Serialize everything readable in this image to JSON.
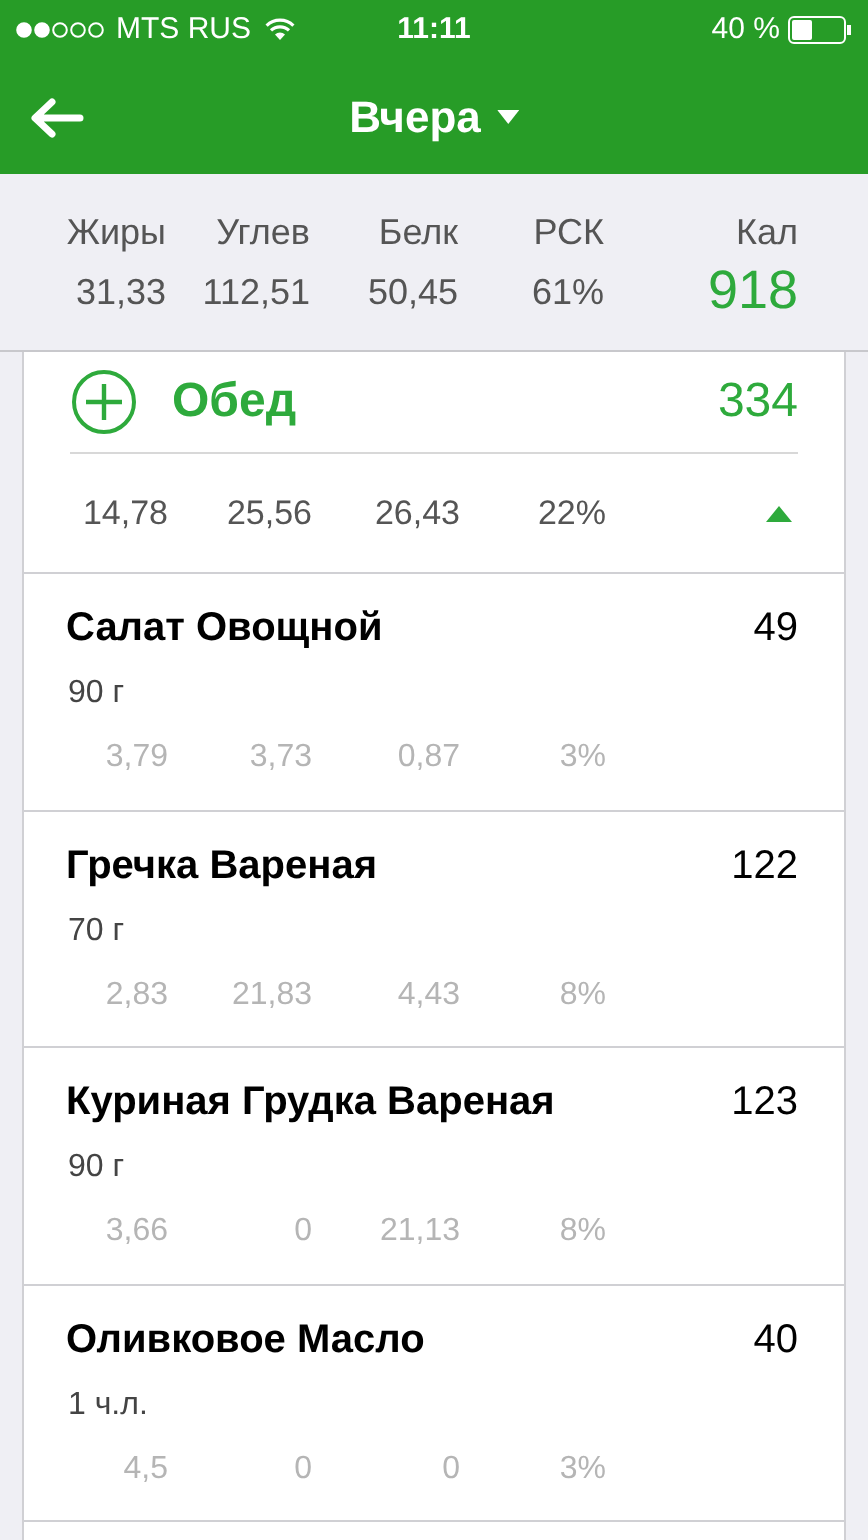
{
  "status_bar": {
    "carrier": "MTS RUS",
    "time": "11:11",
    "battery": "40 %"
  },
  "nav": {
    "title": "Вчера"
  },
  "summary": {
    "labels": [
      "Жиры",
      "Углев",
      "Белк",
      "РСК"
    ],
    "values": [
      "31,33",
      "112,51",
      "50,45",
      "61%"
    ],
    "calories_label": "Кал",
    "calories": "918"
  },
  "meal": {
    "name": "Обед",
    "calories": "334",
    "totals": [
      "14,78",
      "25,56",
      "26,43",
      "22%"
    ],
    "expanded": true,
    "items": [
      {
        "name": "Салат Овощной",
        "calories": "49",
        "portion": "90 г",
        "values": [
          "3,79",
          "3,73",
          "0,87",
          "3%"
        ]
      },
      {
        "name": "Гречка Вареная",
        "calories": "122",
        "portion": "70 г",
        "values": [
          "2,83",
          "21,83",
          "4,43",
          "8%"
        ]
      },
      {
        "name": "Куриная Грудка Вареная",
        "calories": "123",
        "portion": "90 г",
        "values": [
          "3,66",
          "0",
          "21,13",
          "8%"
        ]
      },
      {
        "name": "Оливковое Масло",
        "calories": "40",
        "portion": "1 ч.л.",
        "values": [
          "4,5",
          "0",
          "0",
          "3%"
        ]
      }
    ]
  }
}
